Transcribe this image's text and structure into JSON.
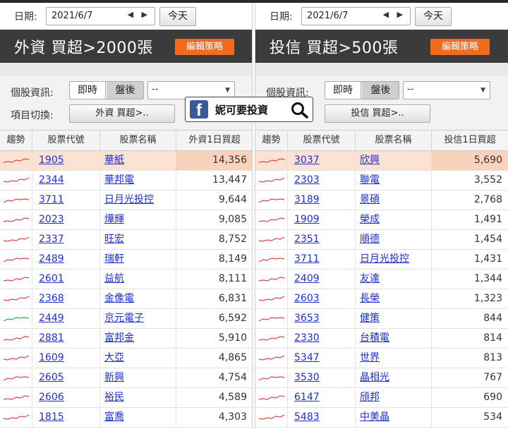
{
  "left": {
    "date_label": "日期:",
    "date_value": "2021/6/7",
    "date_arrows": "◀ ▶",
    "today_label": "今天",
    "title": "外資 買超>2000張",
    "edit_label": "編輯策略",
    "info_label": "個股資訊:",
    "seg_realtime": "即時",
    "seg_after": "盤後",
    "select_value": "--",
    "switch_label": "項目切換:",
    "switch_button": "外資 買超>..",
    "columns": [
      "趨勢",
      "股票代號",
      "股票名稱",
      "外資1日買超"
    ],
    "rows": [
      {
        "code": "1905",
        "name": "華紙",
        "value": "14,356",
        "trend": "red",
        "highlight": true
      },
      {
        "code": "2344",
        "name": "華邦電",
        "value": "13,447",
        "trend": "red"
      },
      {
        "code": "3711",
        "name": "日月光投控",
        "value": "9,644",
        "trend": "red"
      },
      {
        "code": "2023",
        "name": "燁輝",
        "value": "9,085",
        "trend": "red"
      },
      {
        "code": "2337",
        "name": "旺宏",
        "value": "8,752",
        "trend": "red"
      },
      {
        "code": "2489",
        "name": "瑞軒",
        "value": "8,149",
        "trend": "red"
      },
      {
        "code": "2601",
        "name": "益航",
        "value": "8,111",
        "trend": "red"
      },
      {
        "code": "2368",
        "name": "金像電",
        "value": "6,831",
        "trend": "red"
      },
      {
        "code": "2449",
        "name": "京元電子",
        "value": "6,592",
        "trend": "green"
      },
      {
        "code": "2881",
        "name": "富邦金",
        "value": "5,910",
        "trend": "red"
      },
      {
        "code": "1609",
        "name": "大亞",
        "value": "4,865",
        "trend": "red"
      },
      {
        "code": "2605",
        "name": "新興",
        "value": "4,754",
        "trend": "red"
      },
      {
        "code": "2606",
        "name": "裕民",
        "value": "4,589",
        "trend": "red"
      },
      {
        "code": "1815",
        "name": "富喬",
        "value": "4,303",
        "trend": "red"
      }
    ]
  },
  "right": {
    "date_label": "日期:",
    "date_value": "2021/6/7",
    "date_arrows": "◀ ▶",
    "today_label": "今天",
    "title": "投信 買超>500張",
    "edit_label": "編輯策略",
    "info_label": "個股資訊:",
    "seg_realtime": "即時",
    "seg_after": "盤後",
    "select_value": "--",
    "switch_button": "投信 買超>..",
    "columns": [
      "趨勢",
      "股票代號",
      "股票名稱",
      "投信1日買超"
    ],
    "rows": [
      {
        "code": "3037",
        "name": "欣興",
        "value": "5,690",
        "trend": "red",
        "highlight": true
      },
      {
        "code": "2303",
        "name": "聯電",
        "value": "3,552",
        "trend": "red"
      },
      {
        "code": "3189",
        "name": "景碩",
        "value": "2,768",
        "trend": "red"
      },
      {
        "code": "1909",
        "name": "榮成",
        "value": "1,491",
        "trend": "red"
      },
      {
        "code": "2351",
        "name": "順德",
        "value": "1,454",
        "trend": "red"
      },
      {
        "code": "3711",
        "name": "日月光投控",
        "value": "1,431",
        "trend": "red"
      },
      {
        "code": "2409",
        "name": "友達",
        "value": "1,344",
        "trend": "red"
      },
      {
        "code": "2603",
        "name": "長榮",
        "value": "1,323",
        "trend": "red"
      },
      {
        "code": "3653",
        "name": "健策",
        "value": "844",
        "trend": "red"
      },
      {
        "code": "2330",
        "name": "台積電",
        "value": "814",
        "trend": "red"
      },
      {
        "code": "5347",
        "name": "世界",
        "value": "813",
        "trend": "red"
      },
      {
        "code": "3530",
        "name": "晶相光",
        "value": "767",
        "trend": "red"
      },
      {
        "code": "6147",
        "name": "頎邦",
        "value": "690",
        "trend": "red"
      },
      {
        "code": "5483",
        "name": "中美晶",
        "value": "534",
        "trend": "red"
      }
    ]
  },
  "banner": {
    "icon": "facebook-icon",
    "text": "妮可要投資",
    "search_icon": "search-icon"
  },
  "colors": {
    "title_bar": "#3b3b3b",
    "edit_button": "#f26a1b",
    "highlight_row": "#fce2d2",
    "link": "#1f2fcc",
    "trend_red": "#d9473f",
    "trend_green": "#3aa64a",
    "facebook": "#3b5998"
  }
}
